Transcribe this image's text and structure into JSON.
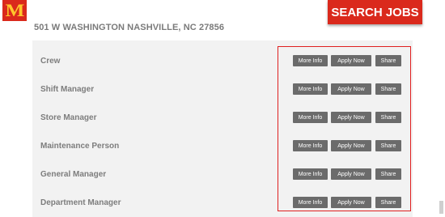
{
  "header": {
    "logo_text": "M",
    "search_jobs_label": "SEARCH JOBS"
  },
  "store": {
    "address": "501 W WASHINGTON NASHVILLE, NC 27856"
  },
  "jobs": [
    {
      "title": "Crew",
      "more_info": "More Info",
      "apply_now": "Apply Now",
      "share": "Share"
    },
    {
      "title": "Shift Manager",
      "more_info": "More Info",
      "apply_now": "Apply Now",
      "share": "Share"
    },
    {
      "title": "Store Manager",
      "more_info": "More Info",
      "apply_now": "Apply Now",
      "share": "Share"
    },
    {
      "title": "Maintenance Person",
      "more_info": "More Info",
      "apply_now": "Apply Now",
      "share": "Share"
    },
    {
      "title": "General Manager",
      "more_info": "More Info",
      "apply_now": "Apply Now",
      "share": "Share"
    },
    {
      "title": "Department Manager",
      "more_info": "More Info",
      "apply_now": "Apply Now",
      "share": "Share"
    }
  ],
  "colors": {
    "brand_red": "#da291c",
    "brand_yellow": "#ffc72c",
    "button_gray": "#6b6b6b",
    "highlight_red": "#e02020"
  }
}
